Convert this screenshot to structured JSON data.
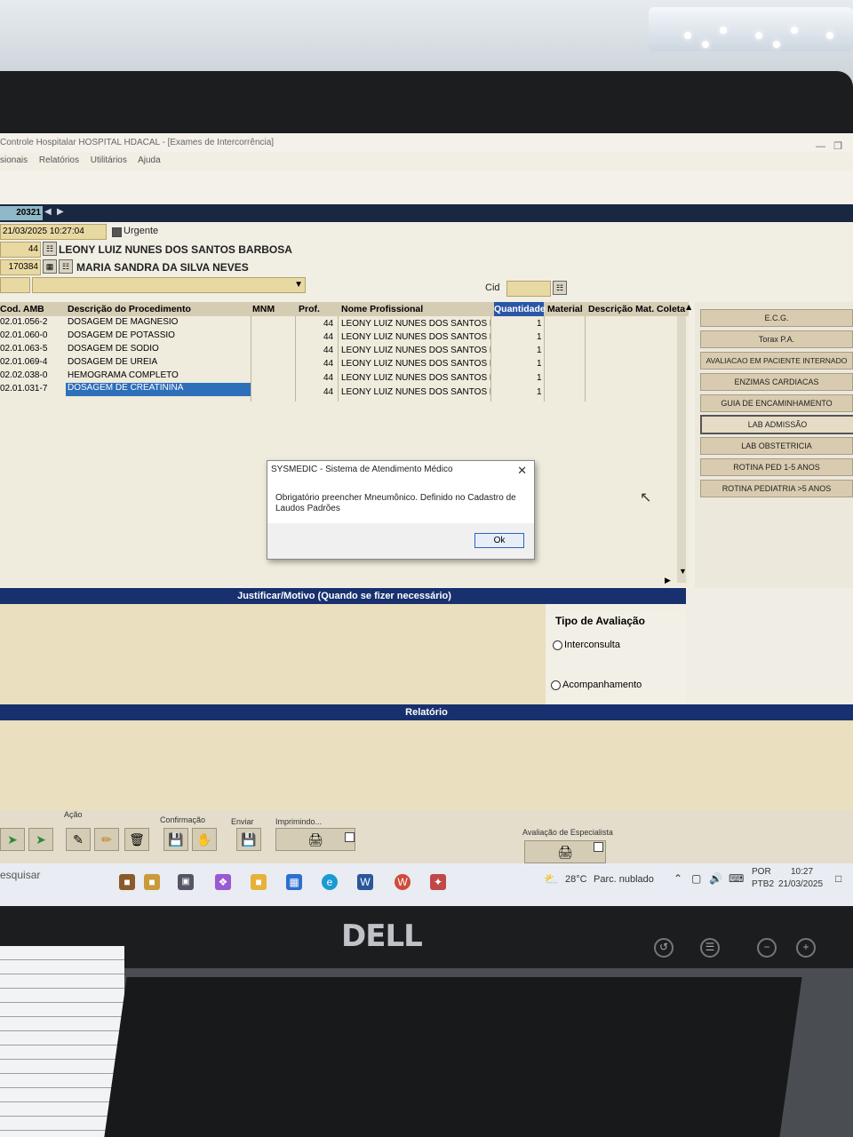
{
  "window": {
    "title": "Controle Hospitalar HOSPITAL HDACAL - [Exames de Intercorrência]",
    "menu": [
      "sionais",
      "Relatórios",
      "Utilitários",
      "Ajuda"
    ]
  },
  "nav": {
    "record_number": "20321"
  },
  "form": {
    "datetime": "21/03/2025 10:27:04",
    "urgent_label": "Urgente",
    "professional_code": "44",
    "professional_name": "LEONY LUIZ NUNES DOS SANTOS BARBOSA",
    "patient_code": "170384",
    "patient_name": "MARIA SANDRA DA SILVA NEVES",
    "cid_label": "Cid"
  },
  "grid": {
    "headers": {
      "cod": "Cod. AMB",
      "desc": "Descrição do Procedimento",
      "mnm": "MNM",
      "prof": "Prof.",
      "nome": "Nome Profissional",
      "qtd": "Quantidade",
      "material": "Material",
      "desc_mat": "Descrição Mat. Coleta"
    },
    "rows": [
      {
        "cod": "02.01.056-2",
        "desc": "DOSAGEM DE MAGNESIO",
        "prof": "44",
        "nome": "LEONY LUIZ NUNES DOS SANTOS E",
        "qtd": "1"
      },
      {
        "cod": "02.01.060-0",
        "desc": "DOSAGEM DE POTASSIO",
        "prof": "44",
        "nome": "LEONY LUIZ NUNES DOS SANTOS E",
        "qtd": "1"
      },
      {
        "cod": "02.01.063-5",
        "desc": "DOSAGEM DE SODIO",
        "prof": "44",
        "nome": "LEONY LUIZ NUNES DOS SANTOS E",
        "qtd": "1"
      },
      {
        "cod": "02.01.069-4",
        "desc": "DOSAGEM DE UREIA",
        "prof": "44",
        "nome": "LEONY LUIZ NUNES DOS SANTOS E",
        "qtd": "1"
      },
      {
        "cod": "02.02.038-0",
        "desc": "HEMOGRAMA COMPLETO",
        "prof": "44",
        "nome": "LEONY LUIZ NUNES DOS SANTOS E",
        "qtd": "1"
      },
      {
        "cod": "02.01.031-7",
        "desc": "DOSAGEM DE CREATININA",
        "prof": "44",
        "nome": "LEONY LUIZ NUNES DOS SANTOS E",
        "qtd": "1"
      }
    ]
  },
  "side_buttons": [
    "E.C.G.",
    "Torax P.A.",
    "AVALIACAO EM PACIENTE INTERNADO",
    "ENZIMAS CARDIACAS",
    "GUIA DE ENCAMINHAMENTO",
    "LAB ADMISSÃO",
    "LAB OBSTETRICIA",
    "ROTINA PED 1-5 ANOS",
    "ROTINA PEDIATRIA >5 ANOS"
  ],
  "dialog": {
    "title": "SYSMEDIC - Sistema de Atendimento Médico",
    "message": "Obrigatório preencher Mneumônico. Definido no Cadastro de Laudos Padrões",
    "ok": "Ok"
  },
  "justify": {
    "title": "Justificar/Motivo  (Quando  se fizer necessário)"
  },
  "avaliacao": {
    "title": "Tipo de Avaliação",
    "option1": "Interconsulta",
    "option2": "Acompanhamento"
  },
  "relatorio": {
    "title": "Relatório"
  },
  "toolbar": {
    "acao": "Ação",
    "confirmacao": "Confirmação",
    "enviar": "Enviar",
    "imprimindo": "Imprimindo...",
    "avaliacao_especialista": "Avaliação de Especialista"
  },
  "taskbar": {
    "search": "esquisar",
    "weather": "28°C",
    "weather_desc": "Parc. nublado",
    "lang": "POR",
    "lang2": "PTB2",
    "time": "10:27",
    "date": "21/03/2025"
  },
  "monitor": {
    "brand": "DELL"
  },
  "colors": {
    "header_blue": "#18306e",
    "selection_blue": "#2e6fba",
    "field_yellow": "#e8d9a3"
  }
}
